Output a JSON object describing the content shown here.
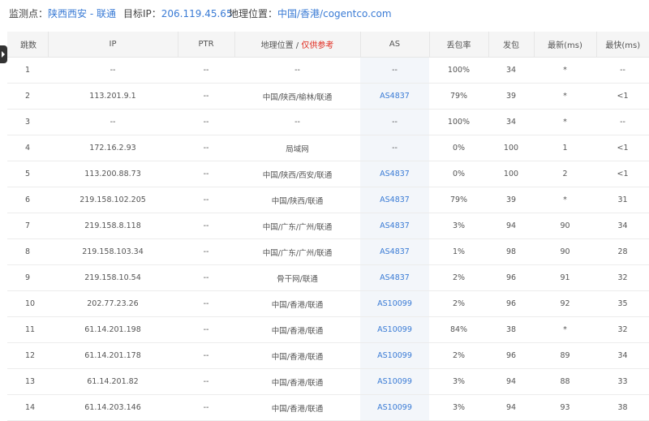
{
  "monitor": {
    "label": "监测点：",
    "value": "陕西西安 - 联通",
    "target_label": "目标IP：",
    "target_value": "206.119.45.65",
    "geo_label": "地理位置：",
    "geo_value": "中国/香港/cogentco.com"
  },
  "table": {
    "headers": {
      "hop": "跳数",
      "ip": "IP",
      "ptr": "PTR",
      "geo": "地理位置 / ",
      "geo_note": "仅供参考",
      "as": "AS",
      "loss": "丢包率",
      "sent": "发包",
      "latest": "最新(ms)",
      "fastest": "最快(ms)"
    },
    "rows": [
      {
        "hop": "1",
        "ip": "--",
        "ptr": "--",
        "geo": "--",
        "as": "--",
        "loss": "100%",
        "sent": "34",
        "latest": "*",
        "fastest": "--"
      },
      {
        "hop": "2",
        "ip": "113.201.9.1",
        "ptr": "--",
        "geo": "中国/陕西/榆林/联通",
        "as": "AS4837",
        "loss": "79%",
        "sent": "39",
        "latest": "*",
        "fastest": "<1"
      },
      {
        "hop": "3",
        "ip": "--",
        "ptr": "--",
        "geo": "--",
        "as": "--",
        "loss": "100%",
        "sent": "34",
        "latest": "*",
        "fastest": "--"
      },
      {
        "hop": "4",
        "ip": "172.16.2.93",
        "ptr": "--",
        "geo": "局域网",
        "as": "--",
        "loss": "0%",
        "sent": "100",
        "latest": "1",
        "fastest": "<1"
      },
      {
        "hop": "5",
        "ip": "113.200.88.73",
        "ptr": "--",
        "geo": "中国/陕西/西安/联通",
        "as": "AS4837",
        "loss": "0%",
        "sent": "100",
        "latest": "2",
        "fastest": "<1"
      },
      {
        "hop": "6",
        "ip": "219.158.102.205",
        "ptr": "--",
        "geo": "中国/陕西/联通",
        "as": "AS4837",
        "loss": "79%",
        "sent": "39",
        "latest": "*",
        "fastest": "31"
      },
      {
        "hop": "7",
        "ip": "219.158.8.118",
        "ptr": "--",
        "geo": "中国/广东/广州/联通",
        "as": "AS4837",
        "loss": "3%",
        "sent": "94",
        "latest": "90",
        "fastest": "34"
      },
      {
        "hop": "8",
        "ip": "219.158.103.34",
        "ptr": "--",
        "geo": "中国/广东/广州/联通",
        "as": "AS4837",
        "loss": "1%",
        "sent": "98",
        "latest": "90",
        "fastest": "28"
      },
      {
        "hop": "9",
        "ip": "219.158.10.54",
        "ptr": "--",
        "geo": "骨干网/联通",
        "as": "AS4837",
        "loss": "2%",
        "sent": "96",
        "latest": "91",
        "fastest": "32"
      },
      {
        "hop": "10",
        "ip": "202.77.23.26",
        "ptr": "--",
        "geo": "中国/香港/联通",
        "as": "AS10099",
        "loss": "2%",
        "sent": "96",
        "latest": "92",
        "fastest": "35"
      },
      {
        "hop": "11",
        "ip": "61.14.201.198",
        "ptr": "--",
        "geo": "中国/香港/联通",
        "as": "AS10099",
        "loss": "84%",
        "sent": "38",
        "latest": "*",
        "fastest": "32"
      },
      {
        "hop": "12",
        "ip": "61.14.201.178",
        "ptr": "--",
        "geo": "中国/香港/联通",
        "as": "AS10099",
        "loss": "2%",
        "sent": "96",
        "latest": "89",
        "fastest": "34"
      },
      {
        "hop": "13",
        "ip": "61.14.201.82",
        "ptr": "--",
        "geo": "中国/香港/联通",
        "as": "AS10099",
        "loss": "3%",
        "sent": "94",
        "latest": "88",
        "fastest": "33"
      },
      {
        "hop": "14",
        "ip": "61.14.203.146",
        "ptr": "--",
        "geo": "中国/香港/联通",
        "as": "AS10099",
        "loss": "3%",
        "sent": "94",
        "latest": "93",
        "fastest": "38"
      }
    ]
  },
  "colors": {
    "accent": "#3a7bd5",
    "note": "#e0281c",
    "header_bg": "#f5f5f5",
    "as_bg": "#f3f6fa"
  },
  "icons": {
    "side_tab": "play-arrow-icon"
  }
}
